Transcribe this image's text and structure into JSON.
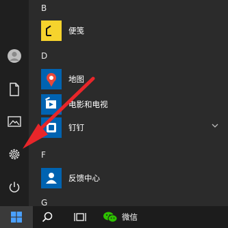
{
  "start_menu": {
    "groups": [
      {
        "letter": "B",
        "apps": [
          {
            "label": "便笺",
            "icon": "sticky-notes-icon"
          }
        ]
      },
      {
        "letter": "D",
        "apps": [
          {
            "label": "地图",
            "icon": "maps-icon"
          },
          {
            "label": "电影和电视",
            "icon": "movies-tv-icon"
          },
          {
            "label": "钉钉",
            "icon": "dingtalk-icon"
          }
        ]
      },
      {
        "letter": "F",
        "apps": [
          {
            "label": "反馈中心",
            "icon": "feedback-hub-icon"
          }
        ]
      },
      {
        "letter": "G",
        "apps": []
      }
    ]
  },
  "rail": {
    "items": [
      "user-avatar",
      "documents-icon",
      "pictures-icon",
      "settings-icon",
      "power-icon"
    ]
  },
  "taskbar": {
    "wechat_label": "微信"
  },
  "colors": {
    "tile_blue": "#0063b1",
    "sticky_yellow": "#f6d32d",
    "arrow_red": "#e8262a",
    "start_blue": "#4aa0ff"
  }
}
